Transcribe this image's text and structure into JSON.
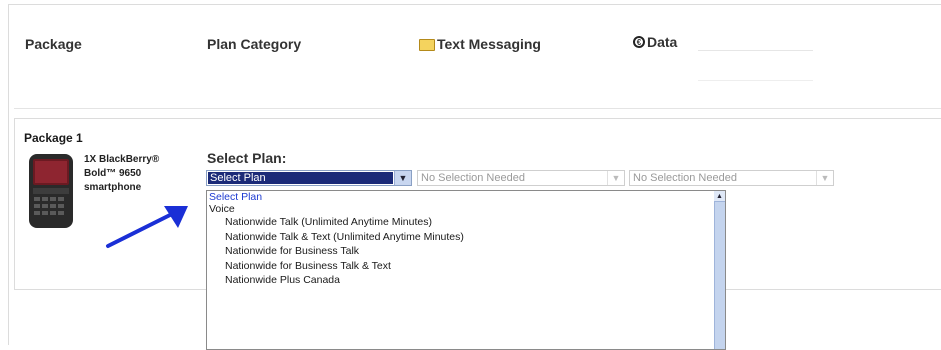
{
  "header": {
    "package": "Package",
    "plan_category": "Plan Category",
    "text_messaging": "Text Messaging",
    "data": "Data"
  },
  "package1": {
    "title": "Package 1",
    "device_lines": [
      "1X BlackBerry®",
      "Bold™ 9650",
      "smartphone"
    ],
    "select_label": "Select Plan:",
    "plan_select_value": "Select Plan",
    "text_select_value": "No Selection Needed",
    "data_select_value": "No Selection Needed",
    "dropdown": {
      "selected": "Select Plan",
      "group": "Voice",
      "options": [
        "Nationwide Talk (Unlimited Anytime Minutes)",
        "Nationwide Talk & Text (Unlimited Anytime Minutes)",
        "Nationwide for Business Talk",
        "Nationwide for Business Talk & Text",
        "Nationwide Plus Canada"
      ]
    }
  },
  "colors": {
    "arrow": "#1a2fd6",
    "selected_option": "#1d3bd1",
    "select_highlight": "#1b2a78"
  },
  "icons": [
    "folder-icon",
    "data-icon",
    "chevron-down-icon",
    "scroll-up-icon"
  ]
}
